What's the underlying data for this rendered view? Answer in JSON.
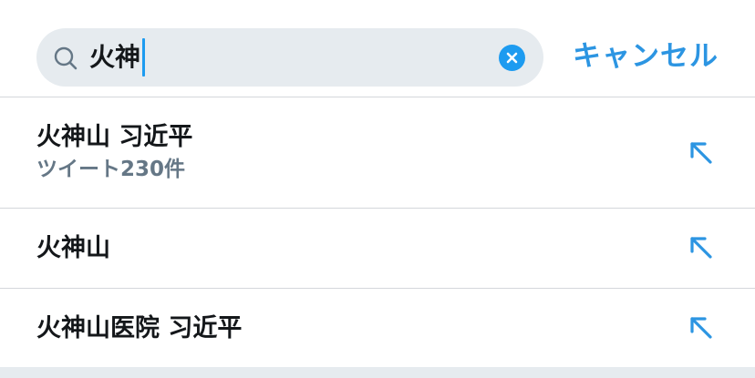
{
  "search": {
    "query": "火神",
    "cancel_label": "キャンセル"
  },
  "suggestions": [
    {
      "title": "火神山 习近平",
      "subtitle": "ツイート230件"
    },
    {
      "title": "火神山"
    },
    {
      "title": "火神山医院 习近平"
    }
  ],
  "colors": {
    "accent": "#1d9bf0",
    "link": "#2c95e2",
    "search_bg": "#e6ebef",
    "divider": "#d4d7db",
    "secondary_text": "#657786"
  },
  "icons": {
    "search": "search-icon",
    "clear": "clear-icon",
    "fill_query": "arrow-up-left-icon"
  }
}
